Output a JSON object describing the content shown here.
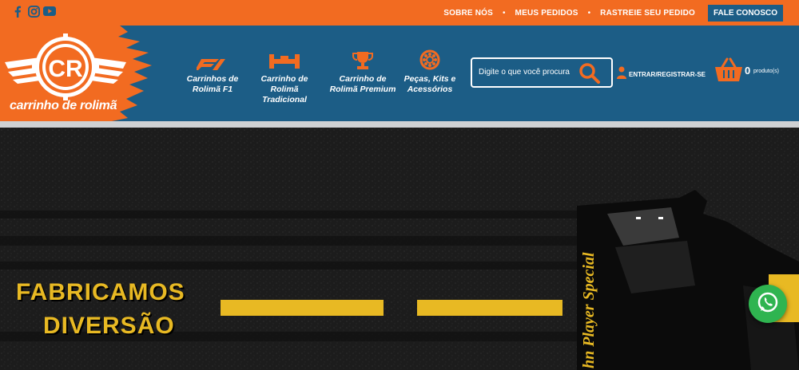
{
  "topbar": {
    "social_icons": [
      "facebook-icon",
      "instagram-icon",
      "youtube-icon"
    ],
    "links": [
      "SOBRE NÓS",
      "MEUS PEDIDOS",
      "RASTREIE SEU PEDIDO"
    ],
    "separator": "•",
    "contact_label": "FALE CONOSCO"
  },
  "header": {
    "logo_initials": "CR",
    "brand_name": "carrinho de rolimã",
    "nav": [
      {
        "label": "Carrinhos de Rolimã F1",
        "icon": "f1-logo-icon"
      },
      {
        "label": "Carrinho de Rolimã Tradicional",
        "icon": "cart-vehicle-icon"
      },
      {
        "label": "Carrinho de Rolimã Premium",
        "icon": "trophy-icon"
      },
      {
        "label": "Peças, Kits e Acessórios",
        "icon": "bearing-icon"
      }
    ],
    "search_placeholder": "Digite o que você procura",
    "login_label": "ENTRAR/REGISTRAR-SE",
    "cart_count": "0",
    "cart_label": "produto(s)"
  },
  "hero": {
    "line1": "FABRICAMOS",
    "line2": "DIVERSÃO",
    "car_text": "hn Player Special"
  },
  "colors": {
    "orange": "#f26b21",
    "blue": "#1c5d86",
    "yellow": "#e8b923",
    "whatsapp": "#2fb450"
  },
  "floating": {
    "whatsapp_icon": "whatsapp-icon"
  }
}
